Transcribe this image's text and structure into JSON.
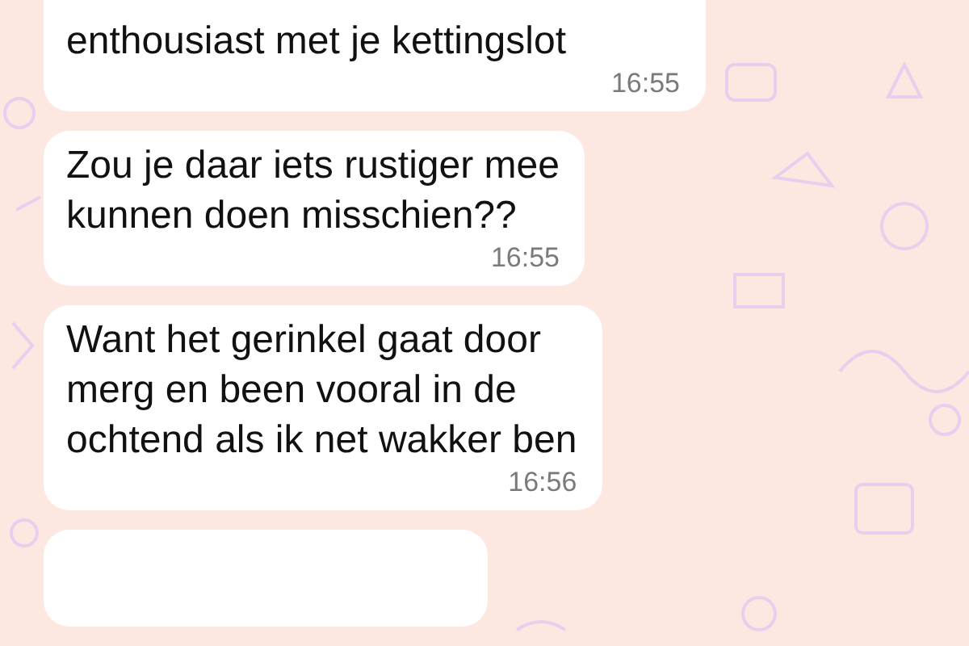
{
  "chat": {
    "messages": [
      {
        "kind": "text",
        "text": "enthousiast met je kettingslot",
        "time": "16:55"
      },
      {
        "kind": "text",
        "text": "Zou je daar iets rustiger mee\nkunnen doen misschien??",
        "time": "16:55"
      },
      {
        "kind": "text",
        "text": "Want het gerinkel gaat door\nmerg en been vooral in de\nochtend als ik net wakker ben",
        "time": "16:56"
      },
      {
        "kind": "clipped"
      }
    ]
  }
}
